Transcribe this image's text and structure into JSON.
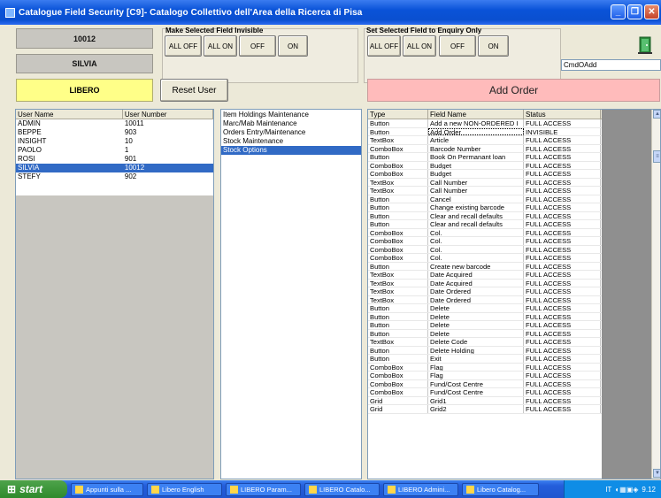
{
  "window": {
    "title": "Catalogue Field Security [C9]- Catalogo Collettivo dell'Area della Ricerca di Pisa"
  },
  "user_number_display": "10012",
  "user_name_display": "SILVIA",
  "invisible_group": {
    "label": "Make Selected Field Invisible",
    "buttons": [
      "ALL OFF",
      "ALL ON",
      "OFF",
      "ON"
    ]
  },
  "enquiry_group": {
    "label": "Set Selected Field to Enquiry Only",
    "buttons": [
      "ALL OFF",
      "ALL ON",
      "OFF",
      "ON"
    ]
  },
  "control_name_field": "CmdOAdd",
  "libero_label": "LIBERO",
  "reset_user_label": "Reset User",
  "selected_field_label": "Add Order",
  "users": {
    "headers": [
      "User Name",
      "User Number"
    ],
    "rows": [
      [
        "ADMIN",
        "10011"
      ],
      [
        "BEPPE",
        "903"
      ],
      [
        "INSIGHT",
        "10"
      ],
      [
        "PAOLO",
        "1"
      ],
      [
        "ROSI",
        "901"
      ],
      [
        "SILVIA",
        "10012"
      ],
      [
        "STEFY",
        "902"
      ]
    ],
    "selected_index": 5
  },
  "modules": {
    "items": [
      "Item Holdings Maintenance",
      "Marc/Mab Maintenance",
      "Orders Entry/Maintenance",
      "Stock Maintenance",
      "Stock Options"
    ],
    "selected_index": 4
  },
  "fields": {
    "headers": [
      "Type",
      "Field Name",
      "Status"
    ],
    "rows": [
      [
        "Button",
        "Add a new NON-ORDERED I",
        "FULL ACCESS"
      ],
      [
        "Button",
        "Add Order",
        "INVISIBLE"
      ],
      [
        "TextBox",
        "Article",
        "FULL ACCESS"
      ],
      [
        "ComboBox",
        "Barcode Number",
        "FULL ACCESS"
      ],
      [
        "Button",
        "Book On Permanant loan",
        "FULL ACCESS"
      ],
      [
        "ComboBox",
        "Budget",
        "FULL ACCESS"
      ],
      [
        "ComboBox",
        "Budget",
        "FULL ACCESS"
      ],
      [
        "TextBox",
        "Call Number",
        "FULL ACCESS"
      ],
      [
        "TextBox",
        "Call Number",
        "FULL ACCESS"
      ],
      [
        "Button",
        "Cancel",
        "FULL ACCESS"
      ],
      [
        "Button",
        "Change existing barcode",
        "FULL ACCESS"
      ],
      [
        "Button",
        "Clear and recall defaults",
        "FULL ACCESS"
      ],
      [
        "Button",
        "Clear and recall defaults",
        "FULL ACCESS"
      ],
      [
        "ComboBox",
        "Col.",
        "FULL ACCESS"
      ],
      [
        "ComboBox",
        "Col.",
        "FULL ACCESS"
      ],
      [
        "ComboBox",
        "Col.",
        "FULL ACCESS"
      ],
      [
        "ComboBox",
        "Col.",
        "FULL ACCESS"
      ],
      [
        "Button",
        "Create new barcode",
        "FULL ACCESS"
      ],
      [
        "TextBox",
        "Date Acquired",
        "FULL ACCESS"
      ],
      [
        "TextBox",
        "Date Acquired",
        "FULL ACCESS"
      ],
      [
        "TextBox",
        "Date Ordered",
        "FULL ACCESS"
      ],
      [
        "TextBox",
        "Date Ordered",
        "FULL ACCESS"
      ],
      [
        "Button",
        "Delete",
        "FULL ACCESS"
      ],
      [
        "Button",
        "Delete",
        "FULL ACCESS"
      ],
      [
        "Button",
        "Delete",
        "FULL ACCESS"
      ],
      [
        "Button",
        "Delete",
        "FULL ACCESS"
      ],
      [
        "TextBox",
        "Delete Code",
        "FULL ACCESS"
      ],
      [
        "Button",
        "Delete Holding",
        "FULL ACCESS"
      ],
      [
        "Button",
        "Exit",
        "FULL ACCESS"
      ],
      [
        "ComboBox",
        "Flag",
        "FULL ACCESS"
      ],
      [
        "ComboBox",
        "Flag",
        "FULL ACCESS"
      ],
      [
        "ComboBox",
        "Fund/Cost Centre",
        "FULL ACCESS"
      ],
      [
        "ComboBox",
        "Fund/Cost Centre",
        "FULL ACCESS"
      ],
      [
        "Grid",
        "Grid1",
        "FULL ACCESS"
      ],
      [
        "Grid",
        "Grid2",
        "FULL ACCESS"
      ]
    ]
  },
  "taskbar": {
    "start_label": "start",
    "tasks": [
      "Appunti sulla ...",
      "Libero English",
      "LIBERO Param...",
      "LIBERO Catalo...",
      "LIBERO Admini...",
      "Libero Catalog..."
    ],
    "language": "IT",
    "clock": "9.12"
  }
}
